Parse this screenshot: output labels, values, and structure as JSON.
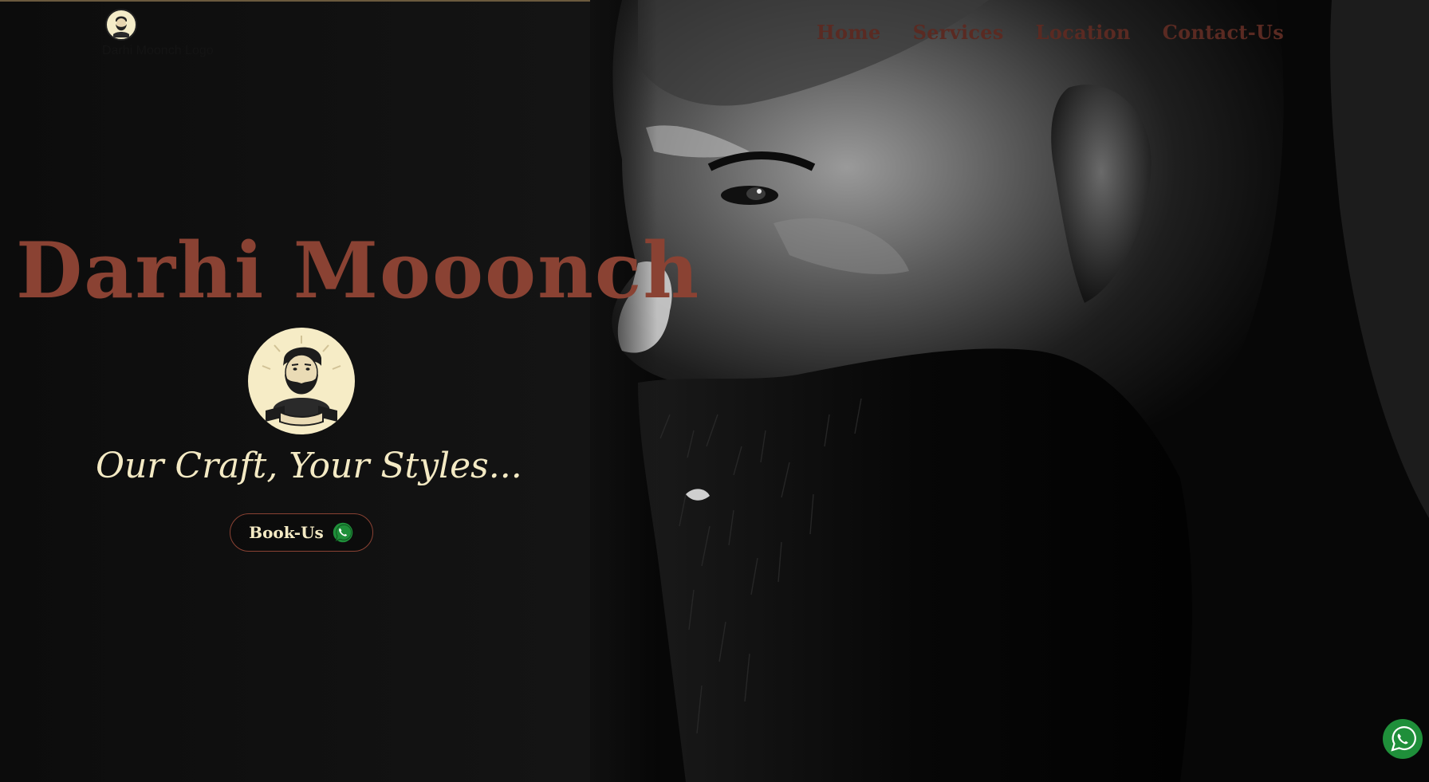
{
  "header": {
    "logo_alt": "Darhi Moonch Logo",
    "nav": [
      {
        "label": "Home"
      },
      {
        "label": "Services"
      },
      {
        "label": "Location"
      },
      {
        "label": "Contact-Us"
      }
    ]
  },
  "hero": {
    "title": "Darhi Mooonch",
    "tagline": "Our Craft, Your Styles...",
    "cta_label": "Book-Us"
  },
  "icons": {
    "whatsapp": "whatsapp-icon",
    "logo": "bearded-man-emblem"
  },
  "colors": {
    "brand": "#8a4233",
    "nav": "#5a2a22",
    "cream": "#f4eac4",
    "whatsapp": "#1f8f3a",
    "background": "#0c0c0c"
  }
}
